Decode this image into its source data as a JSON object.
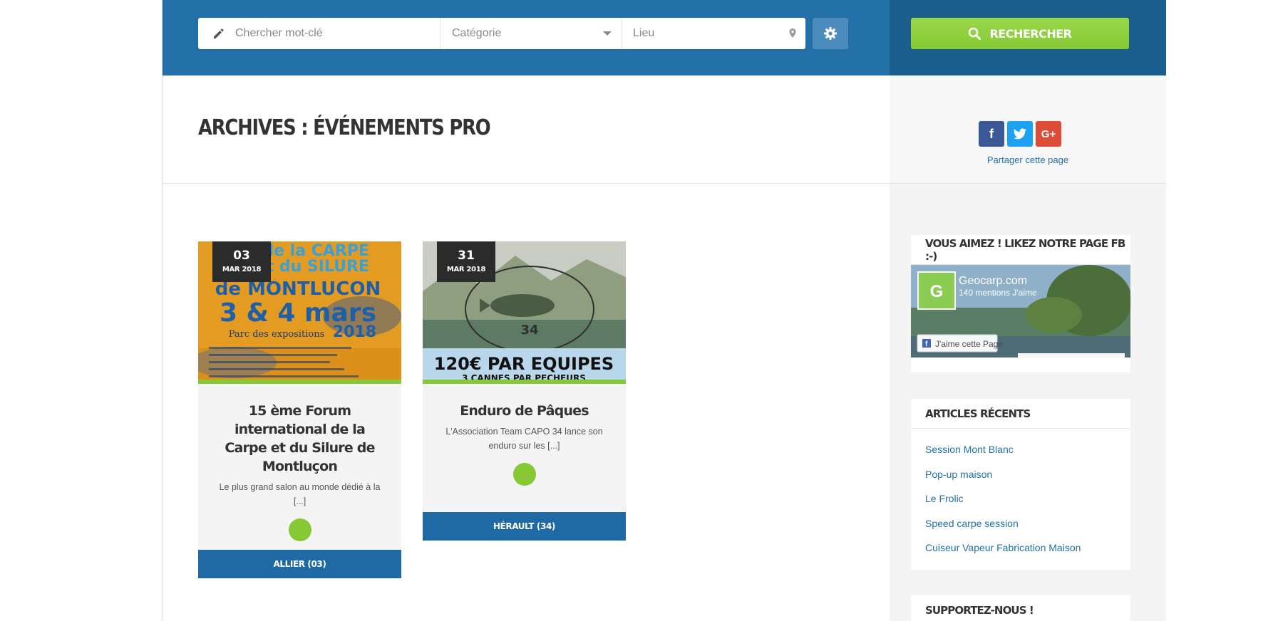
{
  "search": {
    "keyword_placeholder": "Chercher mot-clé",
    "category_label": "Catégorie",
    "location_placeholder": "Lieu",
    "button_label": "RECHERCHER"
  },
  "page": {
    "title": "ARCHIVES : ÉVÉNEMENTS PRO"
  },
  "share": {
    "label": "Partager cette page",
    "icons": [
      "facebook-icon",
      "twitter-icon",
      "google-plus-icon"
    ]
  },
  "events": [
    {
      "day": "03",
      "month": "MAR 2018",
      "title": "15 ème Forum international de la Carpe et du Silure de Montluçon",
      "excerpt": "Le plus grand salon au monde dédié à la [...]",
      "location": "ALLIER (03)",
      "poster": {
        "line1": "de la CARPE",
        "line2": "et du SILURE",
        "city": "de MONTLUCON",
        "dates": "3 & 4 mars",
        "venue": "Parc des expositions",
        "year": "2018"
      }
    },
    {
      "day": "31",
      "month": "MAR 2018",
      "title": "Enduro de Pâques",
      "excerpt": "L'Association Team CAPO 34 lance son enduro sur les [...]",
      "location": "HÉRAULT (34)",
      "poster": {
        "banner": "120€ PAR EQUIPES",
        "sub": "3 CANNES PAR PECHEURS",
        "number": "34"
      }
    }
  ],
  "sidebar": {
    "fb_widget": {
      "title": "VOUS AIMEZ ! LIKEZ NOTRE PAGE FB :-)",
      "page_name": "Geocarp.com",
      "likes": "140 mentions J'aime",
      "like_button": "J'aime cette Page",
      "avatar_letter": "G"
    },
    "recent": {
      "title": "ARTICLES RÉCENTS",
      "items": [
        "Session Mont Blanc",
        "Pop-up maison",
        "Le Frolic",
        "Speed carpe session",
        "Cuiseur Vapeur Fabrication Maison"
      ]
    },
    "support": {
      "title": "SUPPORTEZ-NOUS !"
    }
  },
  "colors": {
    "header": "#2370a9",
    "header_dark": "#1b5f8f",
    "accent_green": "#86c934",
    "card_footer": "#1f6aa5"
  }
}
